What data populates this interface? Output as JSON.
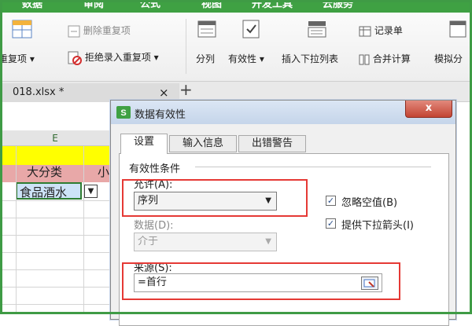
{
  "ribbon": {
    "tabs": [
      "数据",
      "审阅",
      "公式",
      "视图",
      "开发工具",
      "云服务"
    ],
    "remove_duplicates": "删除重复项",
    "highlight_duplicates": "重复项",
    "reject_duplicates": "拒绝录入重复项",
    "split": "分列",
    "validity": "有效性",
    "insert_dropdown": "插入下拉列表",
    "record_sheet": "记录单",
    "consolidate": "合并计算",
    "simulate": "模拟分"
  },
  "file_tab": {
    "name": "018.xlsx *",
    "close": "×",
    "add": "+"
  },
  "sheet": {
    "column": "E",
    "header_cell": "大分类",
    "header_cell_next": "小",
    "selected_cell": "食品酒水",
    "colors": {
      "yellow": "#ffff00",
      "pink": "#e8a8a8",
      "selection": "#2e7d32"
    }
  },
  "dialog": {
    "title": "数据有效性",
    "close_label": "x",
    "tabs": [
      "设置",
      "输入信息",
      "出错警告"
    ],
    "group_title": "有效性条件",
    "allow_label": "允许(A):",
    "allow_value": "序列",
    "data_label": "数据(D):",
    "data_value": "介于",
    "ignore_blank": "忽略空值(B)",
    "dropdown_arrow": "提供下拉箭头(I)",
    "source_label": "来源(S):",
    "source_value": "=首行",
    "highlight_color": "#e53935"
  }
}
